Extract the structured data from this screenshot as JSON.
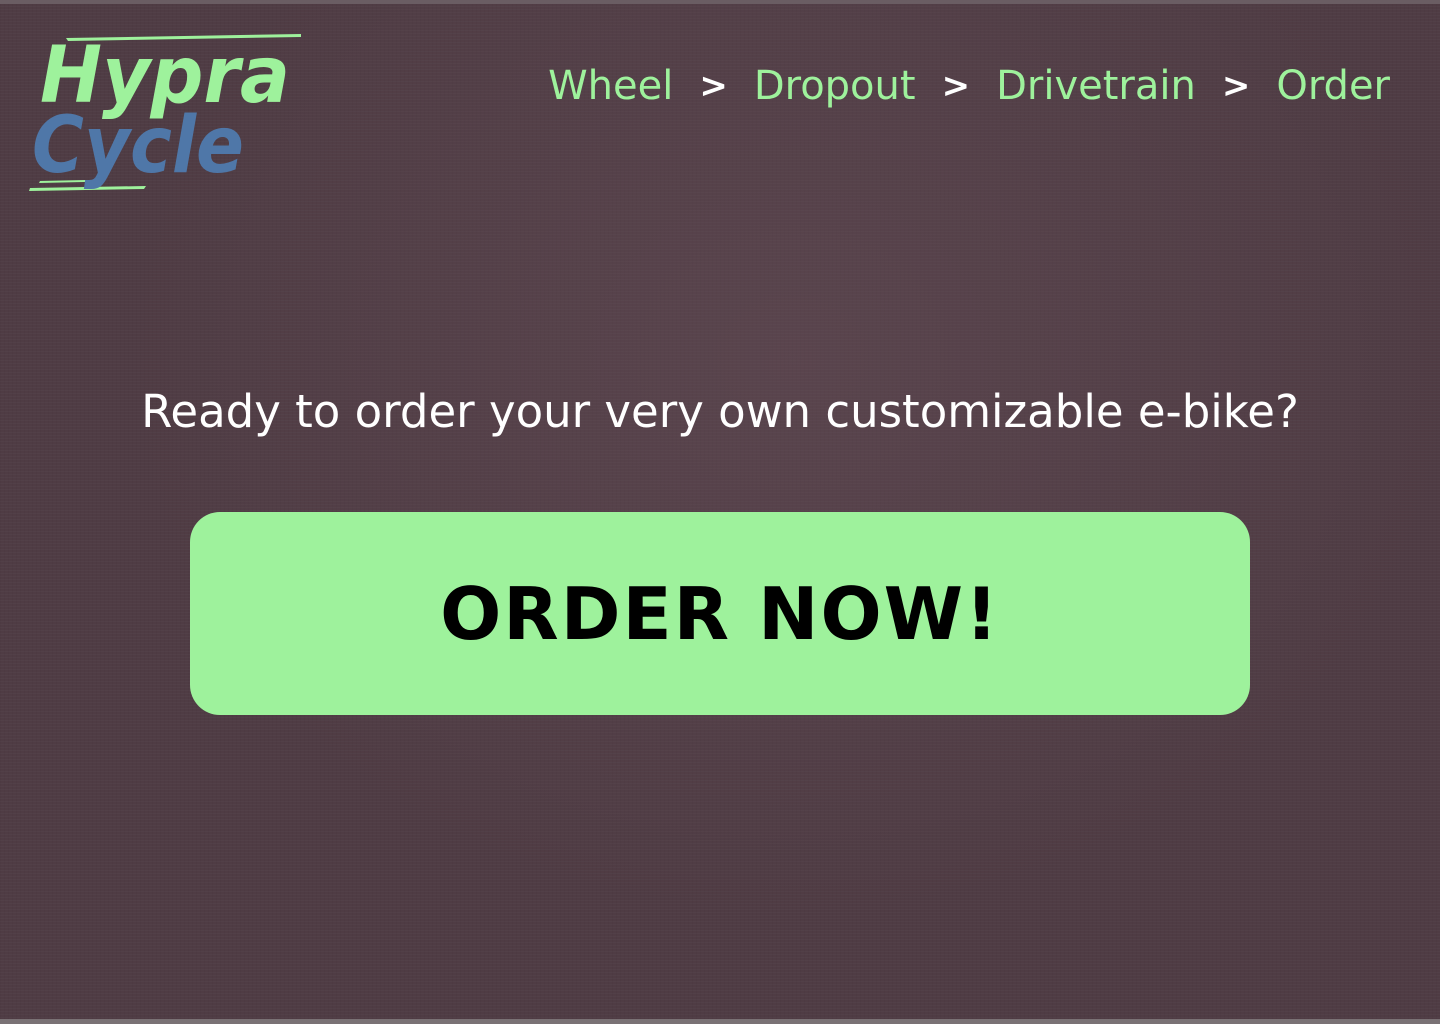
{
  "brand": {
    "logo_line_1": "Hypra",
    "logo_line_2": "Cycle",
    "color_primary": "#9ef29c",
    "color_secondary": "#4f77a8"
  },
  "breadcrumb": {
    "items": [
      {
        "label": "Wheel"
      },
      {
        "label": "Dropout"
      },
      {
        "label": "Drivetrain"
      },
      {
        "label": "Order"
      }
    ],
    "separator": ">"
  },
  "main": {
    "headline": "Ready to order your very own customizable e-bike?",
    "order_button_label": "ORDER NOW!"
  },
  "colors": {
    "background": "#4f3c44",
    "accent": "#9ef29c",
    "text": "#ffffff",
    "button_text": "#000000"
  }
}
